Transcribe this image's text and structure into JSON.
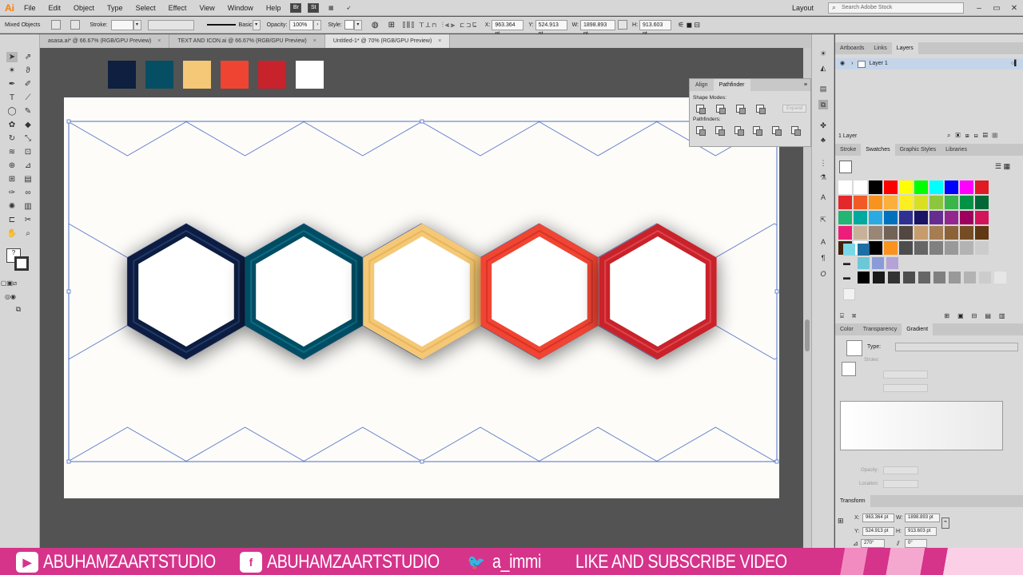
{
  "app": {
    "logo": "Ai",
    "menus": [
      "File",
      "Edit",
      "Object",
      "Type",
      "Select",
      "Effect",
      "View",
      "Window",
      "Help"
    ],
    "workspace": "Layout",
    "search_placeholder": "Search Adobe Stock"
  },
  "controlbar": {
    "selection_type": "Mixed Objects",
    "stroke_label": "Stroke:",
    "brush": "Basic",
    "opacity_label": "Opacity:",
    "opacity_value": "100%",
    "style_label": "Style:",
    "x_label": "X:",
    "x_value": "963.364 pt",
    "y_label": "Y:",
    "y_value": "524.913 pt",
    "w_label": "W:",
    "w_value": "1898.893 pt",
    "h_label": "H:",
    "h_value": "913.603 pt"
  },
  "tabs": [
    {
      "label": "asasa.ai* @ 66.67% (RGB/GPU Preview)",
      "close": "×"
    },
    {
      "label": "TEXT AND ICON.ai @ 66.67% (RGB/GPU Preview)",
      "close": "×"
    },
    {
      "label": "Untitled-1* @ 70% (RGB/GPU Preview)",
      "close": "×"
    }
  ],
  "palette": {
    "colors": [
      "#0e1f3f",
      "#064e64",
      "#f4c877",
      "#f04433",
      "#c8232c",
      "#ffffff"
    ]
  },
  "hexagons": {
    "line_color": "#5a78c8",
    "rings": [
      {
        "outer": "#0e1f3f",
        "inner": "#1e3a6b"
      },
      {
        "outer": "#064e64",
        "inner": "#0b6a84"
      },
      {
        "outer": "#f4c877",
        "inner": "#e8b658"
      },
      {
        "outer": "#f04433",
        "inner": "#d83226"
      },
      {
        "outer": "#c8232c",
        "inner": "#e2434b"
      }
    ]
  },
  "pathfinder": {
    "tabs": [
      "Align",
      "Pathfinder"
    ],
    "shape_modes_label": "Shape Modes:",
    "pathfinders_label": "Pathfinders:",
    "expand": "Expand"
  },
  "layers_panel": {
    "tabs": [
      "Artboards",
      "Links",
      "Layers"
    ],
    "layer_name": "Layer 1",
    "count": "1 Layer"
  },
  "swatches_panel": {
    "tabs": [
      "Stroke",
      "Swatches",
      "Graphic Styles",
      "Libraries"
    ],
    "rows": [
      [
        "#ffffff",
        "#ffffff",
        "#000000",
        "#ff0000",
        "#ffff00",
        "#00ff00",
        "#00ffff",
        "#0000ff",
        "#ff00ff",
        "#e01b24"
      ],
      [
        "#e4272a",
        "#f15a24",
        "#f7931e",
        "#fbb03b",
        "#fcee21",
        "#d9e021",
        "#8cc63f",
        "#39b54a",
        "#009245",
        "#006837"
      ],
      [
        "#22b573",
        "#00a99d",
        "#29abe2",
        "#0071bc",
        "#2e3192",
        "#1b1464",
        "#662d91",
        "#93278f",
        "#9e005d",
        "#d4145a"
      ],
      [
        "#ed1e79",
        "#c7b299",
        "#998675",
        "#736357",
        "#534741",
        "#c69c6d",
        "#a67c52",
        "#8c6239",
        "#754c24",
        "#603813"
      ],
      [
        "#42210b",
        "#ffffff",
        "#000000",
        "#f7931e",
        "#4d4d4d",
        "#666666",
        "#808080",
        "#999999",
        "#b3b3b3",
        "#cccccc"
      ]
    ]
  },
  "gradient_panel": {
    "tabs": [
      "Color",
      "Transparency",
      "Gradient"
    ],
    "type_label": "Type:",
    "stroke_label": "Stroke:",
    "opacity_label": "Opacity:",
    "location_label": "Location:"
  },
  "transform_panel": {
    "title": "Transform",
    "x_label": "X:",
    "x_value": "963.364 pt",
    "y_label": "Y:",
    "y_value": "524.913 pt",
    "w_label": "W:",
    "w_value": "1898.893 pt",
    "h_label": "H:",
    "h_value": "913.603 pt",
    "rotate": "270°",
    "shear": "0°"
  },
  "banner": {
    "youtube": "ABUHAMZAARTSTUDIO",
    "facebook": "ABUHAMZAARTSTUDIO",
    "twitter": "a_immi",
    "cta": "LIKE AND SUBSCRIBE VIDEO"
  }
}
